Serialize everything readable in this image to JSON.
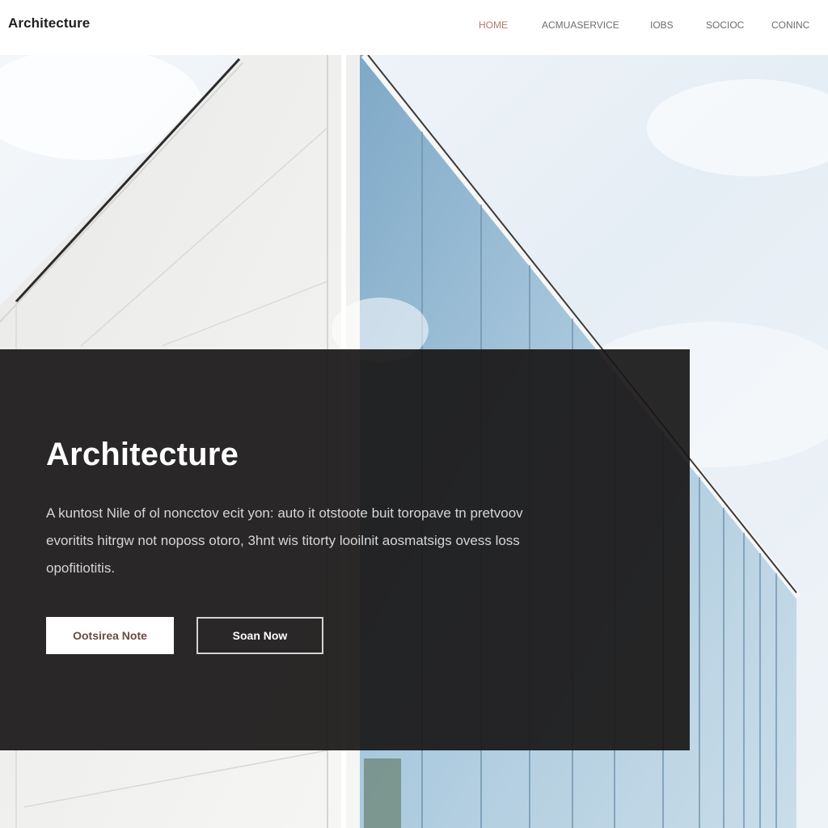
{
  "header": {
    "logo": "Architecture",
    "nav": [
      {
        "label": "HOME",
        "active": true
      },
      {
        "label": "ACMUASERVICE",
        "active": false
      },
      {
        "label": "IOBS",
        "active": false
      },
      {
        "label": "SOCIOC",
        "active": false
      },
      {
        "label": "CONINC",
        "active": false
      }
    ]
  },
  "hero": {
    "image": "modern-white-building-glass-facade",
    "title": "Architecture",
    "description": "A kuntost Nile of ol noncctov ecit yon: auto it otstoote buit toropave tn pretvoov evoritits hitrgw not noposs otoro, 3hnt wis titorty looilnit aosmatsigs ovess loss opofitiotitis.",
    "buttons": {
      "primary": "Ootsirea Note",
      "secondary": "Soan Now"
    }
  },
  "colors": {
    "nav_active": "#b07a6c",
    "overlay": "#181616",
    "primary_button_text": "#6b4a42"
  }
}
